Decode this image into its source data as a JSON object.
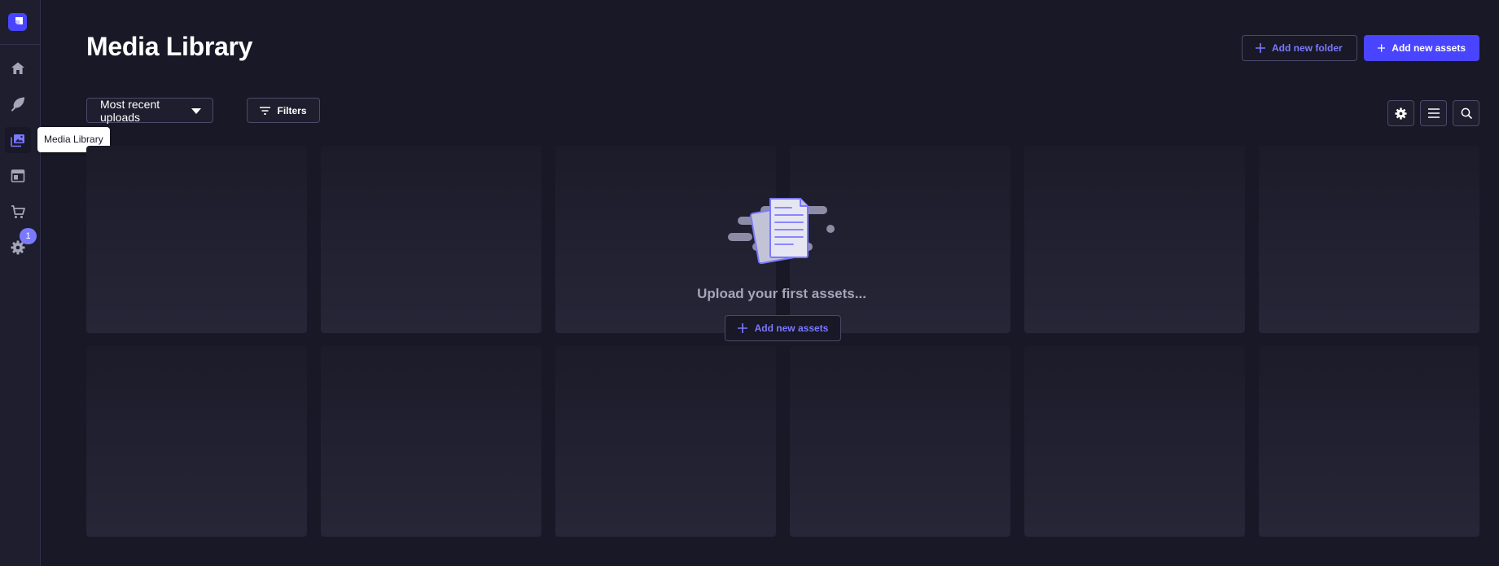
{
  "sidebar": {
    "logo_icon": "strapi-logo-icon",
    "items": [
      {
        "icon": "home-icon"
      },
      {
        "icon": "feather-icon"
      },
      {
        "icon": "media-library-icon",
        "active": true
      },
      {
        "icon": "layout-icon"
      },
      {
        "icon": "cart-icon"
      },
      {
        "icon": "settings-gear-icon",
        "badge": "1"
      }
    ],
    "tooltip": "Media Library"
  },
  "header": {
    "title": "Media Library",
    "add_folder_label": "Add new folder",
    "add_assets_label": "Add new assets"
  },
  "toolbar": {
    "sort_selected": "Most recent uploads",
    "filters_label": "Filters",
    "icons": [
      "settings-gear-icon",
      "list-view-icon",
      "search-icon"
    ]
  },
  "empty_state": {
    "message": "Upload your first assets...",
    "button_label": "Add new assets"
  },
  "colors": {
    "background": "#181826",
    "sidebar": "#1e1e2e",
    "primary": "#4945ff",
    "accent_text": "#7b79ff",
    "border": "#4a4a6a"
  }
}
